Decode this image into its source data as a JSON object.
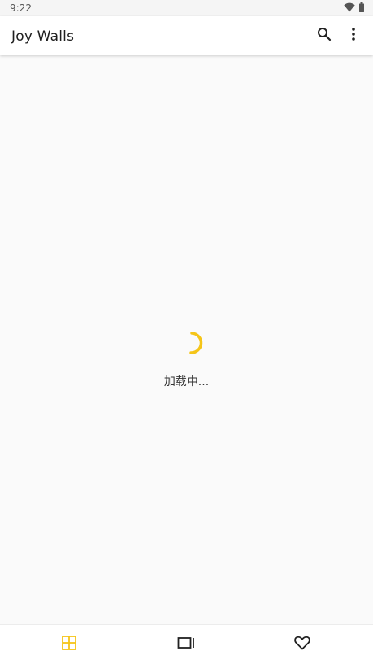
{
  "status_bar": {
    "time": "9:22",
    "icons": [
      "wifi-icon",
      "battery-icon"
    ]
  },
  "app_bar": {
    "title": "Joy Walls",
    "actions": [
      "search-icon",
      "more-vert-icon"
    ]
  },
  "main": {
    "loading_text": "加载中..."
  },
  "bottom_nav": {
    "items": [
      {
        "icon": "grid-icon",
        "active": true
      },
      {
        "icon": "gallery-icon",
        "active": false
      },
      {
        "icon": "heart-icon",
        "active": false
      }
    ]
  },
  "colors": {
    "accent": "#f5c518",
    "inactive_icon": "#212121",
    "background": "#fafafa",
    "surface": "#ffffff"
  }
}
